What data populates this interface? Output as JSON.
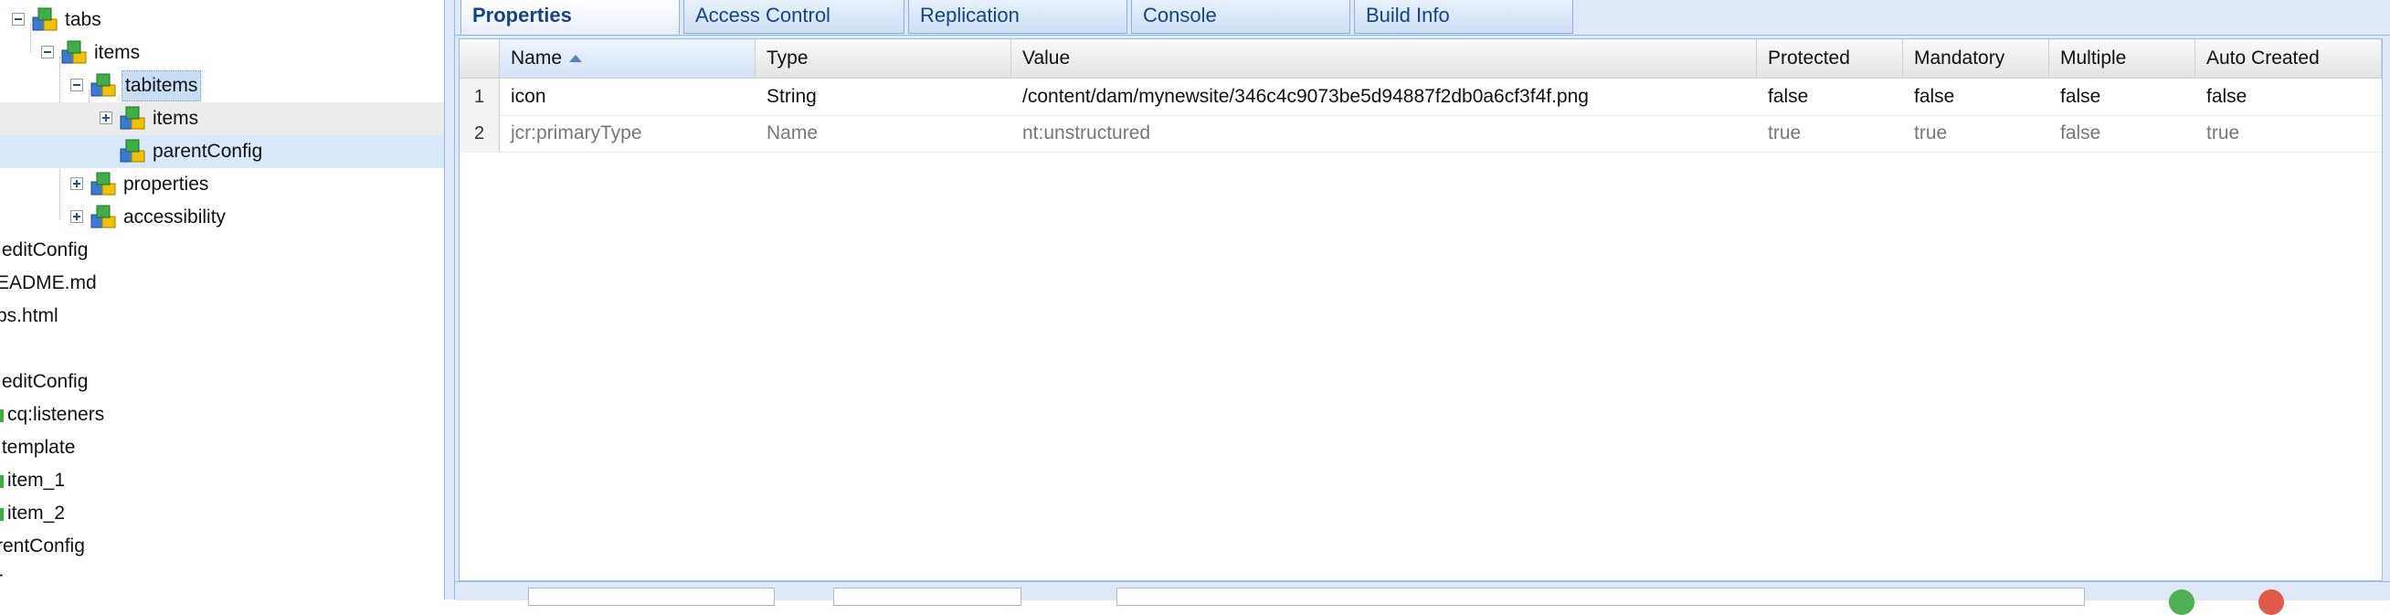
{
  "tree": {
    "nodes": [
      {
        "label": "tabs"
      },
      {
        "label": "items"
      },
      {
        "label": "tabitems"
      },
      {
        "label": "items"
      },
      {
        "label": "parentConfig"
      },
      {
        "label": "properties"
      },
      {
        "label": "accessibility"
      },
      {
        "label": ":editConfig"
      },
      {
        "label": "EADME.md"
      },
      {
        "label": "bs.html"
      },
      {
        "label": ""
      },
      {
        "label": ":editConfig"
      },
      {
        "label": "cq:listeners"
      },
      {
        "label": ":template"
      },
      {
        "label": "item_1"
      },
      {
        "label": "item_2"
      },
      {
        "label": "rentConfig"
      },
      {
        "label": "r"
      }
    ]
  },
  "tabs": [
    {
      "label": "Properties"
    },
    {
      "label": "Access Control"
    },
    {
      "label": "Replication"
    },
    {
      "label": "Console"
    },
    {
      "label": "Build Info"
    }
  ],
  "grid": {
    "columns": [
      "Name",
      "Type",
      "Value",
      "Protected",
      "Mandatory",
      "Multiple",
      "Auto Created"
    ],
    "rows": [
      {
        "num": "1",
        "name": "icon",
        "type": "String",
        "value": "/content/dam/mynewsite/346c4c9073be5d94887f2db0a6cf3f4f.png",
        "protected": "false",
        "mandatory": "false",
        "multiple": "false",
        "auto_created": "false"
      },
      {
        "num": "2",
        "name": "jcr:primaryType",
        "type": "Name",
        "value": "nt:unstructured",
        "protected": "true",
        "mandatory": "true",
        "multiple": "false",
        "auto_created": "true"
      }
    ]
  },
  "colors": {
    "accent": "#15428b",
    "panel": "#dfe8f6",
    "selection": "#c9def5",
    "add_button": "#4caf50",
    "remove_button": "#e05a4a"
  }
}
